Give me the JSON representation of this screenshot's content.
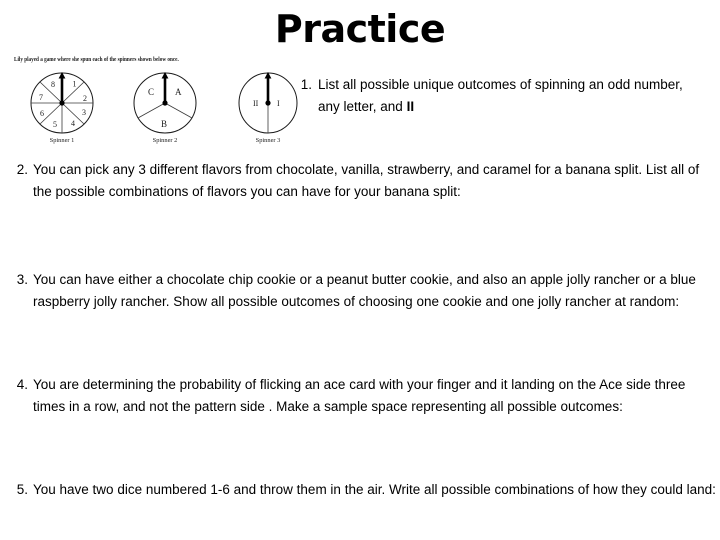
{
  "slide": {
    "title": "Practice",
    "background_color": "#ffffff",
    "text_color": "#000000"
  },
  "figure": {
    "caption": "Lily played a game where she spun each of the spinners shown below once.",
    "spinners": [
      {
        "label": "Spinner 1",
        "sectors": [
          "1",
          "2",
          "3",
          "4",
          "5",
          "6",
          "7",
          "8"
        ],
        "sector_count": 8,
        "pointer": "arrow-up"
      },
      {
        "label": "Spinner 2",
        "sectors": [
          "A",
          "B",
          "C"
        ],
        "sector_count": 3,
        "pointer": "arrow-up"
      },
      {
        "label": "Spinner 3",
        "sectors": [
          "I",
          "II"
        ],
        "sector_count": 2,
        "pointer": "arrow-up"
      }
    ]
  },
  "questions": [
    {
      "number": "1.",
      "text": "List all possible unique outcomes of spinning an odd number, any letter, and ",
      "tail": "II"
    },
    {
      "number": "2.",
      "text": "You can pick any 3 different flavors from chocolate, vanilla, strawberry, and  caramel for a banana split. List all of the possible combinations of flavors  you can have for your banana split:",
      "tail": ""
    },
    {
      "number": "3.",
      "text": "You can have either a chocolate chip cookie or a peanut butter cookie,   and also an apple jolly rancher or a blue raspberry jolly rancher.  Show all possible outcomes of choosing one cookie and one jolly rancher at random:",
      "tail": ""
    },
    {
      "number": "4.",
      "text": "You are determining the probability of  flicking an ace card with your finger and it landing on the Ace side three times in a row, and not the pattern side .  Make a sample space representing all possible outcomes:",
      "tail": ""
    },
    {
      "number": "5.",
      "text": "You have two dice numbered 1-6 and throw them in the air.  Write all possible combinations of how they could land:",
      "tail": ""
    }
  ]
}
